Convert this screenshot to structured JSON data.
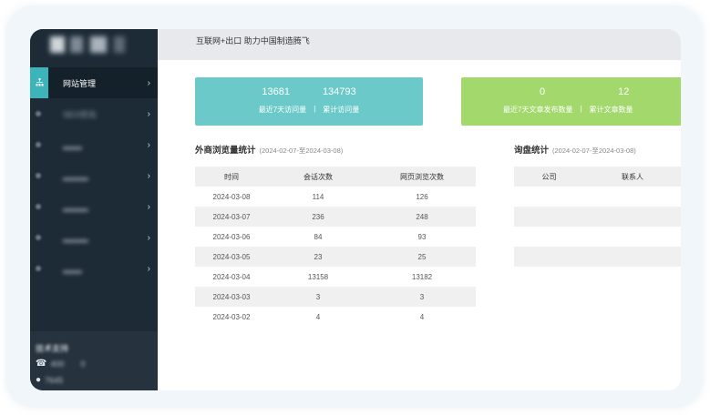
{
  "header": {
    "title": "互联网+出口 助力中国制造腾飞"
  },
  "sidebar": {
    "items": [
      {
        "label": "网站管理",
        "active": true,
        "blurred": false
      },
      {
        "label": "SEO优化",
        "active": false,
        "blurred": true
      },
      {
        "label": "",
        "active": false,
        "blurred": true
      },
      {
        "label": "",
        "active": false,
        "blurred": true
      },
      {
        "label": "",
        "active": false,
        "blurred": true
      },
      {
        "label": "",
        "active": false,
        "blurred": true
      },
      {
        "label": "",
        "active": false,
        "blurred": true
      }
    ],
    "support": {
      "title": "技术支持",
      "phone": "400",
      "phone_tail": "0",
      "qq": "7645"
    }
  },
  "stats": {
    "visits_7d": "13681",
    "visits_total": "134793",
    "visits_7d_label": "最近7天访问量",
    "visits_total_label": "累计访问量",
    "articles_7d": "0",
    "articles_total": "12",
    "articles_7d_label": "最近7天文章发布数量",
    "articles_total_label": "累计文章数量",
    "separator": "|"
  },
  "traffic": {
    "title": "外商浏览量统计",
    "range": "(2024-02-07-至2024-03-08)",
    "columns": [
      "时间",
      "会话次数",
      "网页浏览次数"
    ],
    "rows": [
      [
        "2024-03-08",
        "114",
        "126"
      ],
      [
        "2024-03-07",
        "236",
        "248"
      ],
      [
        "2024-03-06",
        "84",
        "93"
      ],
      [
        "2024-03-05",
        "23",
        "25"
      ],
      [
        "2024-03-04",
        "13158",
        "13182"
      ],
      [
        "2024-03-03",
        "3",
        "3"
      ],
      [
        "2024-03-02",
        "4",
        "4"
      ]
    ]
  },
  "inquiry": {
    "title": "询盘统计",
    "range": "(2024-02-07-至2024-03-08)",
    "columns": [
      "公司",
      "联系人"
    ]
  },
  "colors": {
    "teal": "#6cc9c9",
    "green": "#a3d86c",
    "sidebar": "#1d2b37",
    "accent": "#3cb4ba"
  }
}
